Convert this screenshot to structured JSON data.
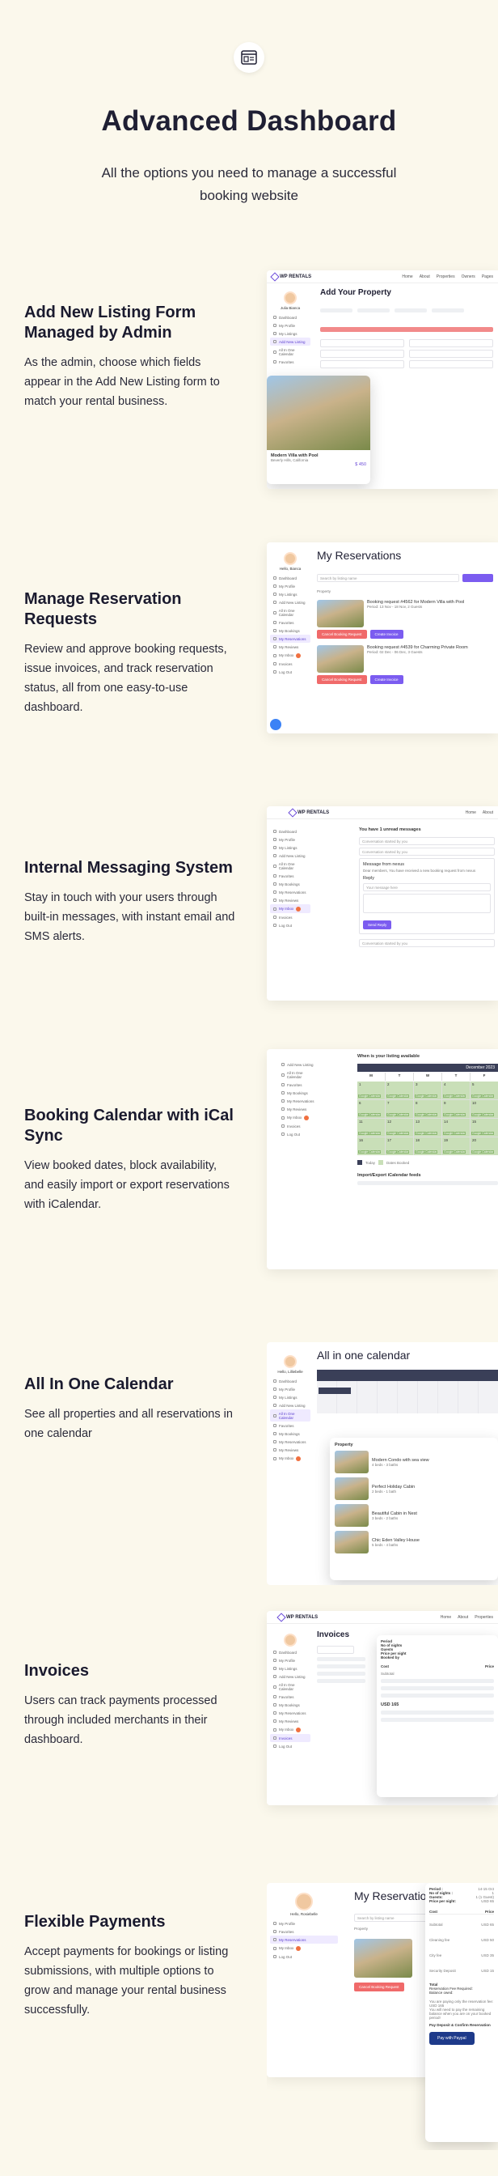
{
  "hero": {
    "title": "Advanced Dashboard",
    "subtitle": "All the options you need to manage a successful booking website",
    "icon": "dashboard-window-icon"
  },
  "features": [
    {
      "title": "Add New Listing Form Managed by Admin",
      "text": "As the admin, choose which fields appear in the Add New Listing form to match your rental business."
    },
    {
      "title": "Manage Reservation Requests",
      "text": "Review and approve booking requests, issue invoices, and track reservation status, all from one easy-to-use dashboard."
    },
    {
      "title": "Internal Messaging System",
      "text": "Stay in touch with your users through built-in messages, with instant email and SMS alerts."
    },
    {
      "title": "Booking Calendar with iCal Sync",
      "text": "View booked dates, block availability, and easily import or export reservations with iCalendar."
    },
    {
      "title": "All In One Calendar",
      "text": "See all properties and all reservations in one calendar"
    },
    {
      "title": "Invoices",
      "text": "Users can track payments processed through included merchants in their dashboard."
    },
    {
      "title": "Flexible Payments",
      "text": "Accept payments for bookings or listing submissions, with multiple options to grow and manage your rental business successfully."
    }
  ],
  "shots": {
    "brand": "WP RENTALS",
    "nav": [
      "Home",
      "About",
      "Properties",
      "Owners",
      "Pages"
    ],
    "sidebar": [
      "Dashboard",
      "My Profile",
      "My Listings",
      "Add New Listing",
      "All In One Calendar",
      "Favorites",
      "My Bookings",
      "My Reservations",
      "My Reviews",
      "My Inbox",
      "Invoices",
      "Log Out"
    ],
    "add_listing": {
      "title": "Add Your Property",
      "user": "Julia Bianca",
      "card_title": "Modern Villa with Pool",
      "card_location": "Beverly Hills, California",
      "card_price": "$ 450"
    },
    "reservations": {
      "title": "My Reservations",
      "label": "Property",
      "user": "Hello, Bianca",
      "rows": [
        {
          "title": "Booking request #4562 for Modern Villa with Pool",
          "meta": "Period: 13 Nov - 18 Nov, 2 Guests",
          "cancel": "Cancel Booking Request",
          "invoice": "Create Invoice"
        },
        {
          "title": "Booking request #4539 for Charming Private Room",
          "meta": "Period: 02 Dec - 06 Dec, 3 Guests",
          "cancel": "Cancel Booking Request",
          "invoice": "Create Invoice"
        }
      ],
      "search": "Search by listing name"
    },
    "messaging": {
      "header": "You have 1 unread messages",
      "items": [
        "Conversation started by you",
        "Conversation started by you"
      ],
      "from": "Message from nexus",
      "body": "Dear members, You have received a new booking request from nexus",
      "reply_label": "Reply",
      "reply_placeholder": "Your message here",
      "send": "Send Reply",
      "later": "Conversation started by you"
    },
    "calendar": {
      "title": "When is your listing available",
      "month": "December 2023",
      "days": [
        "M",
        "T",
        "W",
        "T",
        "F"
      ],
      "booked_label": "Google Calendar",
      "legend_today": "Today",
      "legend_booked": "Dates Booked",
      "import": "Import/Export iCalendar feeds"
    },
    "aio": {
      "title": "All in one calendar",
      "user": "Hello, Lilliebelle",
      "panel_title": "Property",
      "props": [
        {
          "name": "Modern Condo with sea view",
          "meta": "4 beds - 3 baths"
        },
        {
          "name": "Perfect Holiday Cabin",
          "meta": "2 beds - 1 bath"
        },
        {
          "name": "Beautiful Cabin in Nest",
          "meta": "3 beds - 2 baths"
        },
        {
          "name": "Chic Eden Valley House",
          "meta": "5 beds - 4 baths"
        }
      ]
    },
    "invoices": {
      "title": "Invoices",
      "period": "Period",
      "nights": "No of nights",
      "guests": "Guests",
      "price_night": "Price per night",
      "booked_by": "Booked by",
      "cost": "Cost",
      "price": "Price",
      "subtotal": "Subtotal",
      "total_due": "USD 165"
    },
    "payments": {
      "title": "My Reservations",
      "user": "Hello, Rosiebelle",
      "search": "Search by listing name",
      "label": "Property",
      "cancel": "Cancel Booking Request",
      "period": "Period :",
      "period_val": "14-15 Oct",
      "nights": "No of nights :",
      "nights_val": "1",
      "guests": "Guests:",
      "guests_val": "1 (1 Guest)",
      "ppn": "Price per night:",
      "ppn_val": "USD 65",
      "cost": "Cost",
      "price": "Price",
      "subtotal": "Subtotal",
      "subtotal_val": "USD 65",
      "cleaning": "Cleaning fee",
      "cleaning_val": "USD 50",
      "city": "City fee",
      "city_val": "USD 35",
      "security": "Security Deposit",
      "security_val": "USD 15",
      "total": "Total",
      "res_fee": "Reservation Fee Required:",
      "balance": "Balance owed:",
      "paying_only": "You are paying only the reservation fee:",
      "paying_amount": "USD 165",
      "pay_later": "You will need to pay the remaining balance when you are on your booked period!",
      "deposit": "Pay Deposit & Confirm Reservation",
      "paypal": "Pay with Paypal"
    }
  }
}
